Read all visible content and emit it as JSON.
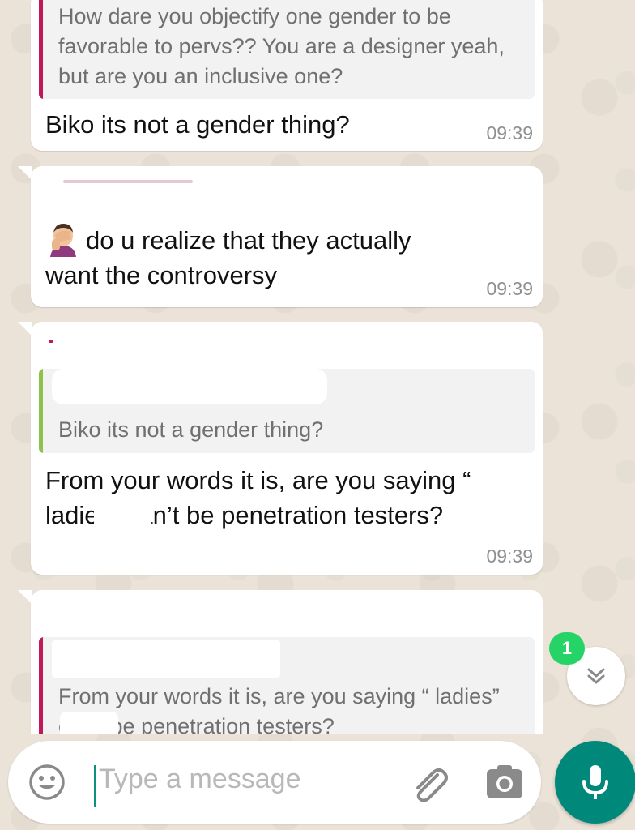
{
  "messages": [
    {
      "quote_text": "How dare you objectify one gender to be favorable to pervs?? You are a designer yeah, but are you an inclusive one?",
      "quote_color": "#c2185b",
      "text": "Biko its not a gender thing?",
      "time": "09:39"
    },
    {
      "text": "do u  realize that they actually want the controversy",
      "emoji": "face-palm-emoji",
      "time": "09:39"
    },
    {
      "quote_text": "Biko its not a gender thing?",
      "quote_color": "#8bc34a",
      "text": "From your words it is, are you saying “        ladies” can’t be penetration testers?",
      "time": "09:39"
    },
    {
      "quote_text": "From your words it is, are you saying “         ladies” can’t be penetration testers?",
      "quote_color": "#c2185b"
    }
  ],
  "composer": {
    "placeholder": "Type a message"
  },
  "scroll_down": {
    "unread_count": "1"
  },
  "colors": {
    "accent": "#00897b",
    "badge": "#25d366"
  }
}
